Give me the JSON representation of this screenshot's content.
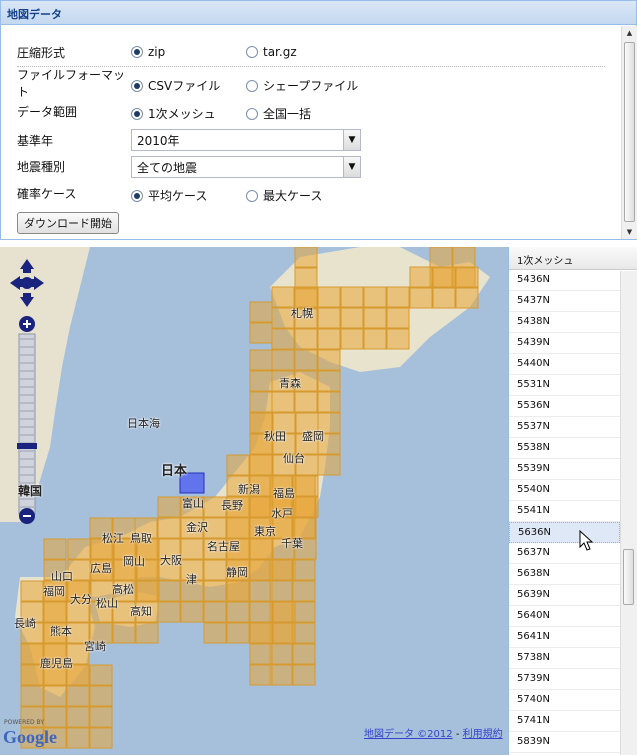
{
  "panel": {
    "title": "地図データ"
  },
  "form": {
    "compression": {
      "label": "圧縮形式",
      "options": [
        "zip",
        "tar.gz"
      ],
      "selected": 0
    },
    "file_format": {
      "label": "ファイルフォーマット",
      "options": [
        "CSVファイル",
        "シェープファイル"
      ],
      "selected": 0
    },
    "data_range": {
      "label": "データ範囲",
      "options": [
        "1次メッシュ",
        "全国一括"
      ],
      "selected": 0
    },
    "base_year": {
      "label": "基準年",
      "value": "2010年"
    },
    "quake_type": {
      "label": "地震種別",
      "value": "全ての地震"
    },
    "probability": {
      "label": "確率ケース",
      "options": [
        "平均ケース",
        "最大ケース"
      ],
      "selected": 0
    },
    "download_label": "ダウンロード開始"
  },
  "map": {
    "labels": {
      "nihonkai": "日本海",
      "nihon": "日本",
      "kankoku": "韓国",
      "sapporo": "札幌",
      "aomori": "青森",
      "akita": "秋田",
      "morioka": "盛岡",
      "sendai": "仙台",
      "niigata": "新潟",
      "fukushima": "福島",
      "toyama": "富山",
      "nagano": "長野",
      "mito": "水戸",
      "kanazawa": "金沢",
      "tokyo": "東京",
      "chiba": "千葉",
      "nagoya": "名古屋",
      "shizuoka": "静岡",
      "matsue": "松江",
      "tottori": "鳥取",
      "hiroshima": "広島",
      "okayama": "岡山",
      "osaka": "大阪",
      "yamaguchi": "山口",
      "fukuoka": "福岡",
      "oita": "大分",
      "matsuyama": "松山",
      "takamatsu": "高松",
      "kochi": "高知",
      "nagasaki": "長崎",
      "kumamoto": "熊本",
      "miyazaki": "宮崎",
      "kagoshima": "鹿児島",
      "tsu": "津"
    },
    "powered_by": "POWERED BY",
    "google": "Google",
    "copyright": "地図データ ©2012",
    "dash": " - ",
    "terms": "利用規約"
  },
  "grid": {
    "header": "1次メッシュ",
    "rows": [
      "5436N",
      "5437N",
      "5438N",
      "5439N",
      "5440N",
      "5531N",
      "5536N",
      "5537N",
      "5538N",
      "5539N",
      "5540N",
      "5541N",
      "5636N",
      "5637N",
      "5638N",
      "5639N",
      "5640N",
      "5641N",
      "5738N",
      "5739N",
      "5740N",
      "5741N",
      "5839N"
    ],
    "selected_index": 12
  }
}
